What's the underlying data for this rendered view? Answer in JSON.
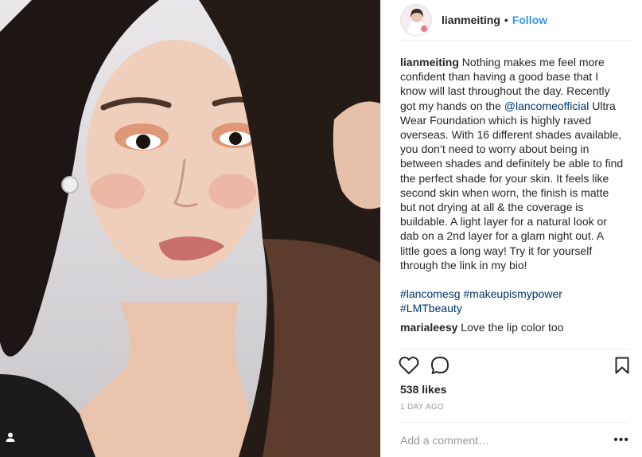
{
  "post": {
    "username": "lianmeiting",
    "separator": "•",
    "follow_label": "Follow",
    "caption": {
      "username": "lianmeiting",
      "text_before_mention": "Nothing makes me feel more confident than having a good base that I know will last throughout the day. Recently got my hands on the ",
      "mention": "@lancomeofficial",
      "text_after_mention": " Ultra Wear Foundation which is highly raved overseas. With 16 different shades available, you don’t need to worry about being in between shades and definitely be able to find the perfect shade for your skin. It feels like second skin when worn, the finish is matte but not drying at all & the coverage is buildable. A light layer for a natural look or dab on a 2nd layer for a glam night out. A little goes a long way! Try it for yourself through the link in my bio!",
      "hashtags": [
        "#lancomesg",
        "#makeupismypower",
        "#LMTbeauty"
      ]
    },
    "comments": [
      {
        "username": "marialeesy",
        "text": "Love the lip color too"
      }
    ],
    "likes": "538 likes",
    "date": "1 DAY AGO",
    "add_comment_placeholder": "Add a comment…",
    "more_label": "•••"
  },
  "icons": {
    "like": "heart-icon",
    "comment": "comment-bubble-icon",
    "save": "bookmark-icon",
    "tagged": "person-tag-icon"
  },
  "colors": {
    "text": "#262626",
    "link": "#003569",
    "follow": "#3897f0",
    "muted": "#999999",
    "divider": "#efefef"
  }
}
